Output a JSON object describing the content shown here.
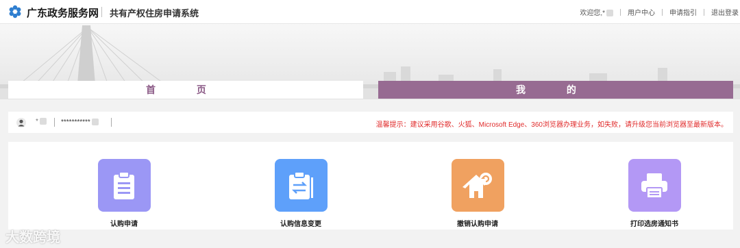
{
  "header": {
    "site_title": "广东政务服务网",
    "system_title": "共有产权住房申请系统",
    "links": {
      "welcome": "欢迎您,*",
      "user_center": "用户中心",
      "guide": "申请指引",
      "logout": "退出登录"
    }
  },
  "tabs": {
    "home": "首 页",
    "mine": "我 的"
  },
  "info": {
    "user_name": "*",
    "id_number": "***********",
    "tip": "温馨提示：建议采用谷歌、火狐、Microsoft Edge、360浏览器办理业务，如失败，请升级您当前浏览器至最新版本。"
  },
  "actions": [
    {
      "label": "认购申请",
      "icon": "clipboard-list-icon",
      "color": "#9b97f5"
    },
    {
      "label": "认购信息变更",
      "icon": "clipboard-swap-icon",
      "color": "#5ea0fa"
    },
    {
      "label": "撤销认购申请",
      "icon": "house-undo-icon",
      "color": "#f0a160"
    },
    {
      "label": "打印选房通知书",
      "icon": "printer-icon",
      "color": "#b398f5"
    }
  ],
  "watermark": "大数跨境",
  "colors": {
    "accent": "#976b92",
    "tip": "#e02a2a"
  }
}
